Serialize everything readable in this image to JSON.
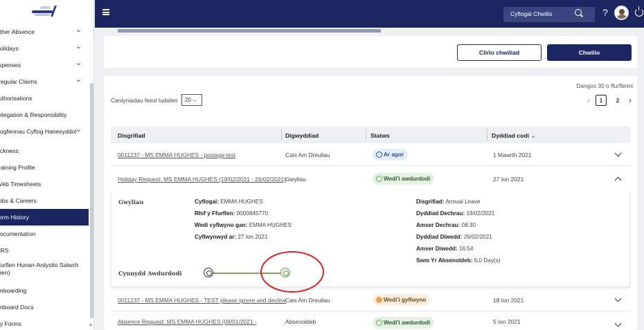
{
  "sidebar": {
    "items": [
      {
        "label": "ither Absence",
        "chevron": true
      },
      {
        "label": "lolidays",
        "chevron": true
      },
      {
        "label": "xpenses",
        "chevron": true
      },
      {
        "label": "regular Claims",
        "chevron": true
      },
      {
        "label": "uthorisations",
        "chevron": false
      },
      {
        "label": "elegation & Responsibility",
        "chevron": false
      },
      {
        "label": "iogfennau Cyflog Hanesyddol",
        "chevron": true
      },
      {
        "label": "ickness",
        "chevron": false
      },
      {
        "label": "raining Profile",
        "chevron": false
      },
      {
        "label": "Veb Timesheets",
        "chevron": false
      },
      {
        "label": "obs & Careers",
        "chevron": false
      },
      {
        "label": "orm History",
        "chevron": false
      },
      {
        "label": "locumentation",
        "chevron": false
      },
      {
        "label": "IRS",
        "chevron": false
      },
      {
        "label": "furflen Hunan-Ardystio Salwch",
        "label2": "ien)",
        "chevron": false
      },
      {
        "label": "inboarding",
        "chevron": false
      },
      {
        "label": "inboard Docs",
        "chevron": false
      },
      {
        "label": "ly Forms",
        "chevron": false
      }
    ],
    "active_index": 11
  },
  "topbar": {
    "search_text": "Cyflogai Chwilio"
  },
  "search_panel": {
    "clear_label": "Clirio chwiliad",
    "search_label": "Chwilio"
  },
  "results": {
    "rpp_label": "Canlyniadau fesul tudalen",
    "rpp_value": "20",
    "showing": "Dangos 30 o ffurflenni",
    "pages": [
      "1",
      "2"
    ],
    "current_page": "1",
    "columns": {
      "description": "Disgrifiad",
      "event": "Digwyddiad",
      "status": "Statws",
      "date": "Dyddiad codi"
    },
    "rows": [
      {
        "description": "0011237 - MS EMMA HUGHES - postage test",
        "event": "Cais Am Dreuliau",
        "status": "Ar agor",
        "status_type": "blue",
        "date": "1 Mawrth 2021"
      },
      {
        "description": "Holiday Request: MS EMMA HUGHES (19/02/2021 - 26/02/2021)",
        "event": "Gwyliau",
        "status": "Wedi'i awdurdodi",
        "status_type": "green",
        "date": "27 Ion 2021"
      },
      {
        "description": "0011237 - MS EMMA HUGHES - TEST please ignore and decline",
        "event": "Cais Am Dreuliau",
        "status": "Wedi'i gyflwyno",
        "status_type": "orange",
        "date": "18 Ion 2021"
      },
      {
        "description": "Absence Request: MS EMMA HUGHES (08/01/2021 -",
        "event": "Absenoldeb",
        "status": "Wedi'i awdurdodi",
        "status_type": "green",
        "date": "5 Ion 2021"
      }
    ]
  },
  "detail": {
    "type_label": "Gwyliau",
    "employee_label": "Cyflogai:",
    "employee_value": "EMMA HUGHES",
    "form_no_label": "Rhif y Ffurflen:",
    "form_no_value": "0000845770",
    "submitted_by_label": "Wedi cyflwyno gan:",
    "submitted_by_value": "EMMA HUGHES",
    "submitted_on_label": "Cyflwynwyd ar:",
    "submitted_on_value": "27 Ion 2021",
    "desc_label": "Disgrifiad:",
    "desc_value": "Annual Leave",
    "start_date_label": "Dyddiad Dechrau:",
    "start_date_value": "19/02/2021",
    "start_time_label": "Amser Dechrau:",
    "start_time_value": "08:30",
    "end_date_label": "Dyddiad Diwedd:",
    "end_date_value": "26/02/2021",
    "end_time_label": "Amser Diwedd:",
    "end_time_value": "16:54",
    "total_label": "Swm Yr Absenoldeb:",
    "total_value": "6.0 Day(s)",
    "progress_label": "Cynnydd Awdurdodi"
  },
  "colors": {
    "navy": "#1c2660",
    "annotation": "#e02020"
  }
}
